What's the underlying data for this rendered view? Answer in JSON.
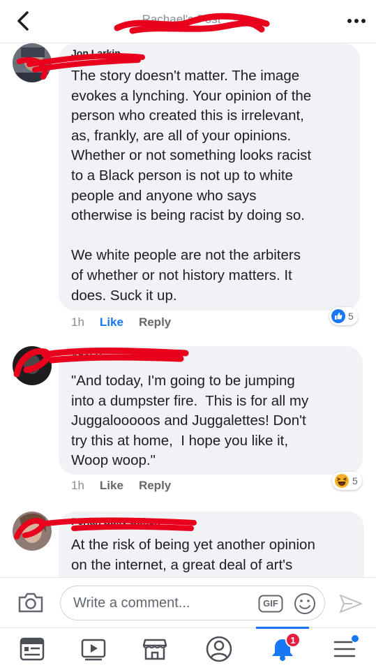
{
  "header": {
    "title": "Rachael's Post",
    "back_icon": "chevron-left-icon",
    "more_icon": "more-dots-icon"
  },
  "comments": [
    {
      "author": "Jon Larkin",
      "text": "The story doesn't matter. The image\nevokes a lynching. Your opinion of the\nperson who created this is irrelevant,\nas, frankly, are all of your opinions.\nWhether or not something looks racist\nto a Black person is not up to white\npeople and anyone who says\notherwise is being racist by doing so.\n\nWe white people are not the arbiters\nof whether or not history matters. It\ndoes. Suck it up.",
      "time": "1h",
      "like_label": "Like",
      "reply_label": "Reply",
      "reaction_icon": "thumbs-up-icon",
      "reaction_count": "5",
      "liked": true
    },
    {
      "author": "Abel Hernandez",
      "text": "\"And today, I'm going to be jumping\ninto a dumpster fire.  This is for all my\nJuggalooooos and Juggalettes! Don't\ntry this at home,  I hope you like it,\nWoop woop.\"",
      "time": "1h",
      "like_label": "Like",
      "reply_label": "Reply",
      "reaction_icon": "laughing-emoji-icon",
      "reaction_count": "5",
      "liked": false
    },
    {
      "author": "Perian Sully Cohen",
      "text": "At the risk of being yet another opinion\non the internet, a great deal of art's",
      "time": "",
      "like_label": "",
      "reply_label": ""
    }
  ],
  "composer": {
    "placeholder": "Write a comment...",
    "gif_label": "GIF",
    "camera_icon": "camera-icon",
    "emoji_icon": "smiley-icon",
    "send_icon": "send-icon"
  },
  "tabbar": {
    "items": [
      "news-feed-icon",
      "watch-icon",
      "marketplace-icon",
      "profile-icon",
      "notifications-icon",
      "menu-icon"
    ],
    "notification_badge": "1",
    "active_color": "#1877f2"
  },
  "colors": {
    "facebook_blue": "#1877f2",
    "bubble_bg": "#f0f2f5",
    "redaction_red": "#e8001c",
    "badge_red": "#e41e3f"
  }
}
